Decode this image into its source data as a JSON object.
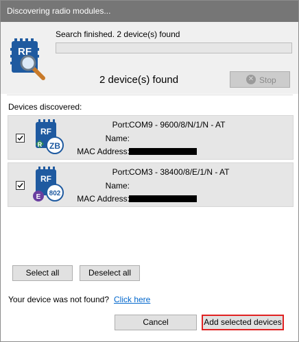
{
  "window": {
    "title": "Discovering radio modules..."
  },
  "search": {
    "status_text": "Search finished. 2 device(s) found",
    "progress_percent": 0,
    "found_text": "2 device(s) found",
    "stop_label": "Stop",
    "rf_icon_text": "RF"
  },
  "devices": {
    "header": "Devices discovered:",
    "port_label": "Port:",
    "name_label": "Name:",
    "mac_label": "MAC Address:",
    "items": [
      {
        "checked": true,
        "port": "COM9 - 9600/8/N/1/N - AT",
        "name": "",
        "badge_left": "R",
        "badge_right": "ZB",
        "badge_left_color": "#2e8b57",
        "rf": "RF"
      },
      {
        "checked": true,
        "port": "COM3 - 38400/8/E/1/N - AT",
        "name": "",
        "badge_left": "E",
        "badge_right": "802",
        "badge_left_color": "#6a3fa0",
        "rf": "RF"
      }
    ]
  },
  "actions": {
    "select_all": "Select all",
    "deselect_all": "Deselect all",
    "not_found": "Your device was not found?",
    "click_here": "Click here",
    "cancel": "Cancel",
    "add_selected": "Add selected devices"
  },
  "colors": {
    "title_bar": "#767676",
    "link": "#0066cc",
    "highlight": "#e02020",
    "xbee_blue": "#1f5aa0"
  }
}
